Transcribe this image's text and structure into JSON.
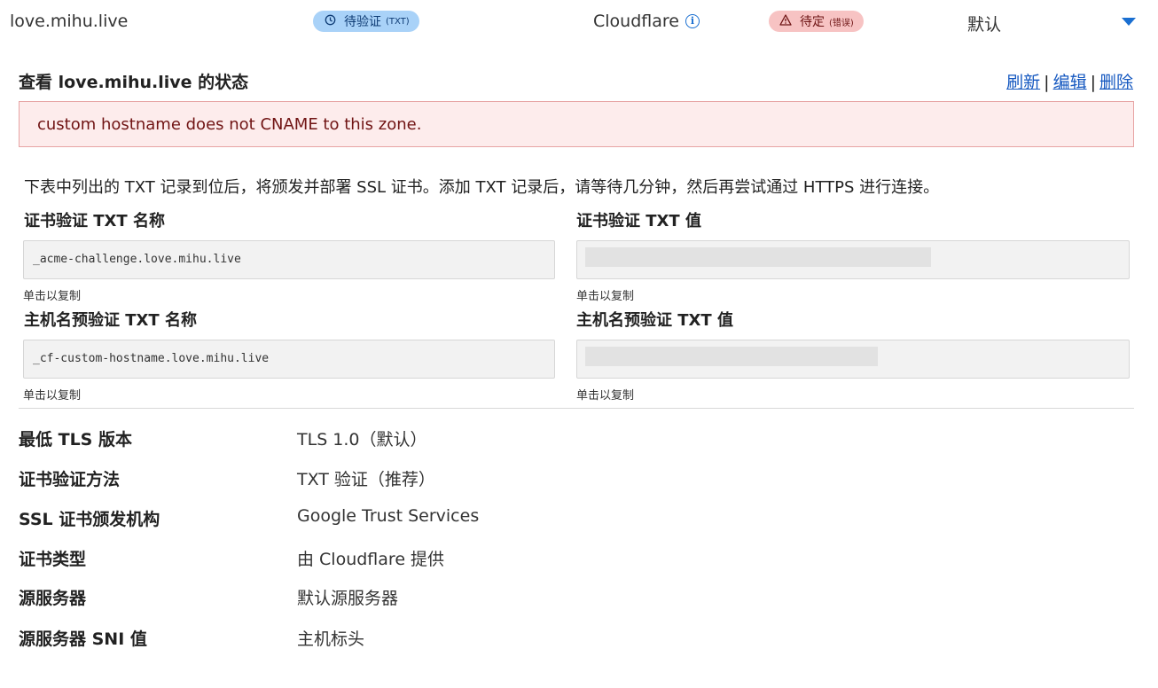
{
  "top_row": {
    "hostname": "love.mihu.live",
    "cert_status_badge": {
      "label": "待验证",
      "sub": "(TXT)",
      "icon": "clock-icon",
      "color": "#a9d2f8"
    },
    "provider": "Cloudflare",
    "hostname_status_badge": {
      "label": "待定",
      "sub": "(错误)",
      "icon": "warning-icon",
      "color": "#f7c3c3"
    },
    "origin": "默认"
  },
  "status_section": {
    "title": "查看 love.mihu.live 的状态",
    "actions": {
      "refresh": "刷新",
      "edit": "编辑",
      "delete": "删除",
      "separator": "|"
    },
    "error_message": "custom hostname does not CNAME to this zone.",
    "description": "下表中列出的 TXT 记录到位后，将颁发并部署 SSL 证书。添加 TXT 记录后，请等待几分钟，然后再尝试通过 HTTPS 进行连接。"
  },
  "txt_records": {
    "cert_txt_name_label": "证书验证 TXT 名称",
    "cert_txt_name_value": "_acme-challenge.love.mihu.live",
    "cert_txt_value_label": "证书验证 TXT 值",
    "hostname_txt_name_label": "主机名预验证 TXT 名称",
    "hostname_txt_name_value": "_cf-custom-hostname.love.mihu.live",
    "hostname_txt_value_label": "主机名预验证 TXT 值",
    "copy_hint": "单击以复制"
  },
  "details": [
    {
      "label": "最低 TLS 版本",
      "value": "TLS 1.0（默认）"
    },
    {
      "label": "证书验证方法",
      "value": "TXT 验证（推荐）"
    },
    {
      "label": "SSL 证书颁发机构",
      "value": "Google Trust Services"
    },
    {
      "label": "证书类型",
      "value": "由 Cloudflare 提供"
    },
    {
      "label": "源服务器",
      "value": "默认源服务器"
    },
    {
      "label": "源服务器 SNI 值",
      "value": "主机标头"
    }
  ],
  "colors": {
    "link": "#1558c0",
    "error_bg": "#fdecec",
    "error_border": "#e7a4a4",
    "accent": "#1a6fd1"
  }
}
